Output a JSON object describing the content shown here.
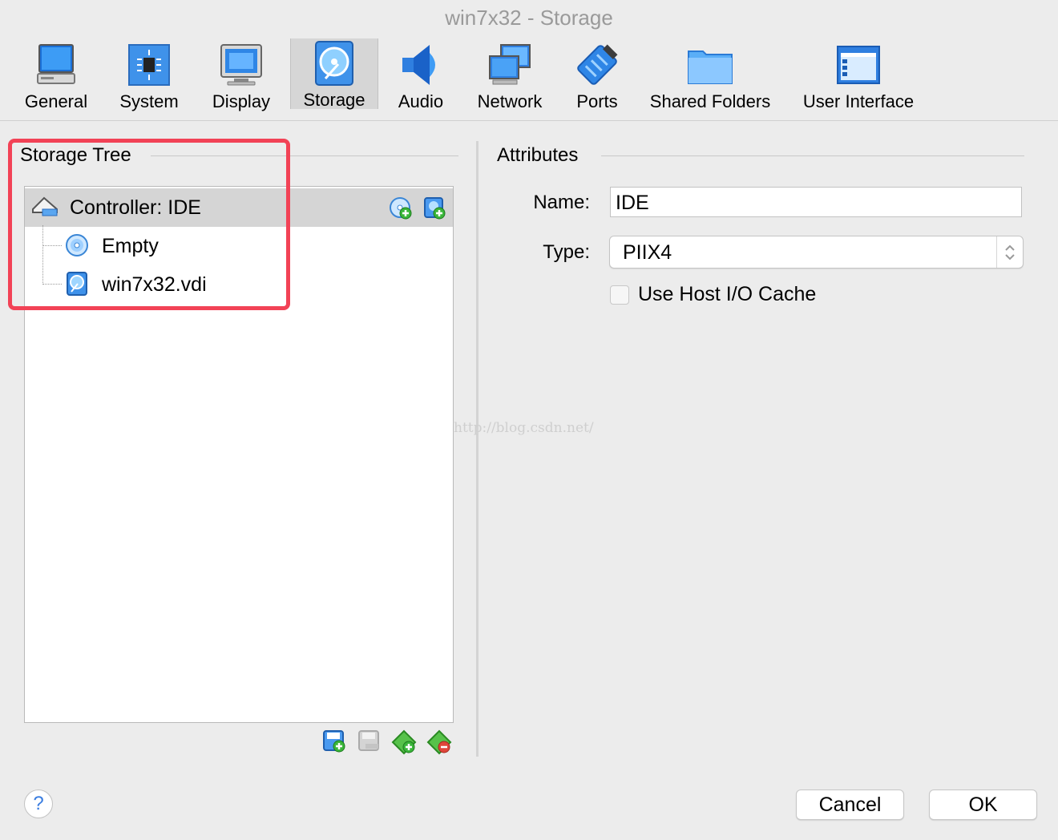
{
  "window": {
    "title": "win7x32 - Storage"
  },
  "toolbar": {
    "items": [
      {
        "label": "General",
        "icon": "general-icon"
      },
      {
        "label": "System",
        "icon": "system-icon"
      },
      {
        "label": "Display",
        "icon": "display-icon"
      },
      {
        "label": "Storage",
        "icon": "storage-icon",
        "selected": true
      },
      {
        "label": "Audio",
        "icon": "audio-icon"
      },
      {
        "label": "Network",
        "icon": "network-icon"
      },
      {
        "label": "Ports",
        "icon": "ports-icon"
      },
      {
        "label": "Shared Folders",
        "icon": "shared-folders-icon"
      },
      {
        "label": "User Interface",
        "icon": "user-interface-icon"
      }
    ]
  },
  "storage_tree": {
    "title": "Storage Tree",
    "controller": {
      "label": "Controller: IDE",
      "icon": "ide-controller-icon"
    },
    "children": [
      {
        "label": "Empty",
        "icon": "optical-disc-icon"
      },
      {
        "label": "win7x32.vdi",
        "icon": "hard-disk-icon"
      }
    ]
  },
  "attributes": {
    "title": "Attributes",
    "name_label": "Name:",
    "name_value": "IDE",
    "type_label": "Type:",
    "type_value": "PIIX4",
    "host_cache_label": "Use Host I/O Cache",
    "host_cache_checked": false
  },
  "footer": {
    "help_label": "?",
    "cancel_label": "Cancel",
    "ok_label": "OK"
  },
  "watermark": "http://blog.csdn.net/",
  "colors": {
    "highlight": "#f24256",
    "accent": "#3a7de0"
  }
}
